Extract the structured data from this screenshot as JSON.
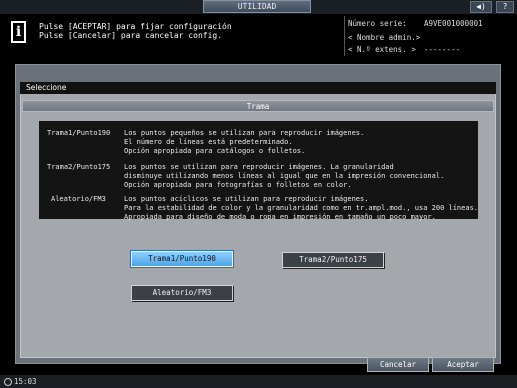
{
  "header": {
    "title": "UTILIDAD",
    "volume_icon": "◀)",
    "help_label": "?"
  },
  "message": {
    "line1": "Pulse [ACEPTAR] para fijar configuración",
    "line2": "Pulse [Cancelar] para cancelar config."
  },
  "device": {
    "serial_label": "Número serie:",
    "serial_value": "A9VE001000001",
    "admin_label": "< Nombre admin.>",
    "ext_label": "< N.º extens. >",
    "ext_value": "--------"
  },
  "dialog": {
    "header": "Seleccione",
    "section_title": "Trama",
    "descriptions": [
      {
        "label": "Trama1/Punto190",
        "lines": [
          "Los puntos pequeños se utilizan para reproducir imágenes.",
          "El número de líneas está predeterminado.",
          "Opción apropiada para catálogos o folletos."
        ]
      },
      {
        "label": "Trama2/Punto175",
        "lines": [
          "Los puntos se utilizan para reproducir imágenes. La granularidad",
          "disminuye utilizando menos líneas al igual que en la impresión convencional.",
          "Opción apropiada para fotografías o folletos en color."
        ]
      },
      {
        "label": "Aleatorio/FM3",
        "lines": [
          "Los puntos acíclicos se utilizan para reproducir imágenes.",
          "Para la estabilidad de color y la granularidad como en tr.ampl.mod., usa 200 líneas.",
          "Apropiada para diseño de moda o ropa en impresión en tamaño un poco mayor."
        ]
      }
    ],
    "options": {
      "opt1": "Trama1/Punto190",
      "opt2": "Trama2/Punto175",
      "opt3": "Aleatorio/FM3"
    },
    "selected": "opt1"
  },
  "footer": {
    "cancel_label": "Cancelar",
    "accept_label": "Aceptar",
    "time": "15:03"
  }
}
